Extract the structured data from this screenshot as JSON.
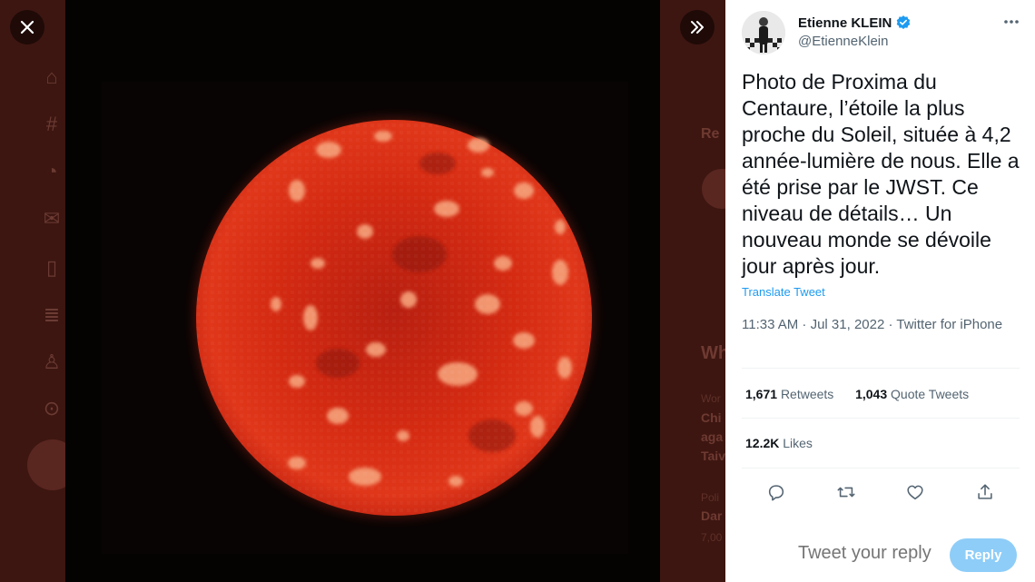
{
  "author": {
    "name": "Etienne KLEIN",
    "handle": "@EtienneKlein",
    "verified": true
  },
  "tweet": {
    "text": "Photo de Proxima du Centaure, l’étoile la plus proche du Soleil, située à 4,2 année-lumière de nous. Elle a été prise par le JWST. Ce niveau de détails… Un nouveau monde se dévoile jour après jour.",
    "translate_label": "Translate Tweet",
    "timestamp": "11:33 AM · Jul 31, 2022 · Twitter for iPhone"
  },
  "stats": {
    "retweets_count": "1,671",
    "retweets_label": "Retweets",
    "quotes_count": "1,043",
    "quotes_label": "Quote Tweets",
    "likes_count": "12.2K",
    "likes_label": "Likes"
  },
  "reply": {
    "placeholder": "Tweet your reply",
    "button_label": "Reply"
  },
  "background_ghost": {
    "t1": "Re",
    "t2": "Wh",
    "t3": "Wor",
    "t4": "Chi",
    "t5": "aga",
    "t6": "Taiv",
    "t7": "Poli",
    "t8": "Dar",
    "t9": "7,00"
  },
  "colors": {
    "accent": "#1d9bf0",
    "reply_button": "#8ecdf8",
    "photo_background": "#050202",
    "star_red": "#d42a12"
  },
  "icons": {
    "close": "close-icon",
    "expand": "double-chevron-right-icon",
    "verified": "verified-badge-icon",
    "more": "more-horizontal-icon",
    "reply": "reply-icon",
    "retweet": "retweet-icon",
    "like": "heart-icon",
    "share": "share-icon"
  }
}
